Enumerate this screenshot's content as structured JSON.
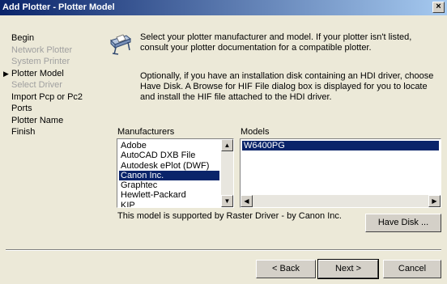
{
  "window": {
    "title": "Add Plotter - Plotter Model",
    "close_label": "×"
  },
  "steps": [
    {
      "label": "Begin",
      "state": "normal"
    },
    {
      "label": "Network Plotter",
      "state": "disabled"
    },
    {
      "label": "System Printer",
      "state": "disabled"
    },
    {
      "label": "Plotter Model",
      "state": "current"
    },
    {
      "label": "Select Driver",
      "state": "disabled"
    },
    {
      "label": "Import Pcp or Pc2",
      "state": "normal"
    },
    {
      "label": "Ports",
      "state": "normal"
    },
    {
      "label": "Plotter Name",
      "state": "normal"
    },
    {
      "label": "Finish",
      "state": "normal"
    }
  ],
  "current_step_marker": "▶",
  "instructions": {
    "paragraph1": "Select your plotter manufacturer and model. If your plotter isn't listed, consult your plotter documentation for a compatible plotter.",
    "paragraph2": "Optionally, if you have an installation disk containing an HDI driver, choose Have Disk. A Browse for HIF File dialog box is displayed for you to locate and install the HIF file attached to the HDI driver."
  },
  "manufacturers": {
    "label": "Manufacturers",
    "items": [
      "Adobe",
      "AutoCAD DXB File",
      "Autodesk ePlot (DWF)",
      "Canon Inc.",
      "Graphtec",
      "Hewlett-Packard",
      "KIP"
    ],
    "selected": "Canon Inc."
  },
  "models": {
    "label": "Models",
    "items": [
      "W6400PG"
    ],
    "selected": "W6400PG"
  },
  "driver_info": "This model is supported by Raster Driver - by Canon Inc.",
  "buttons": {
    "have_disk": "Have Disk ...",
    "back": "< Back",
    "next": "Next >",
    "cancel": "Cancel"
  },
  "icons": {
    "plotter": "plotter-icon",
    "close": "close-icon"
  },
  "colors": {
    "title_start": "#0a246a",
    "title_end": "#a6caf0",
    "selection": "#0a246a",
    "dialog_bg": "#ece9d8"
  }
}
